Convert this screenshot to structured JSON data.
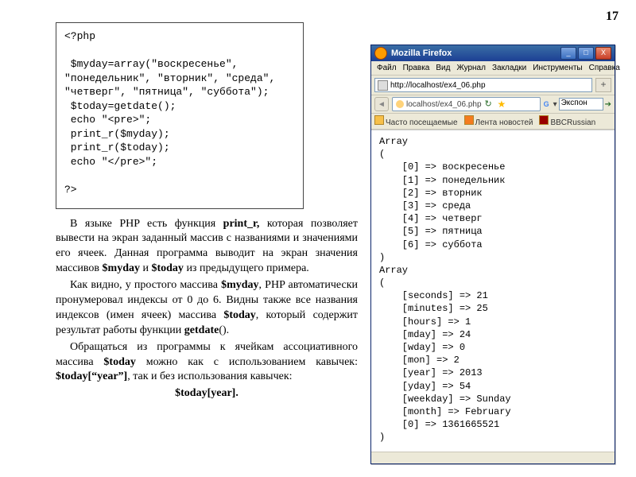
{
  "page_number": "17",
  "code": {
    "lines": [
      "<?php",
      "",
      " $myday=array(\"воскресенье\",",
      "\"понедельник\", \"вторник\", \"среда\",",
      "\"четверг\", \"пятница\", \"суббота\");",
      " $today=getdate();",
      " echo \"<pre>\";",
      " print_r($myday);",
      " print_r($today);",
      " echo \"</pre>\";",
      "",
      "?>"
    ]
  },
  "text": {
    "p1_a": "В  языке PHP есть  функция ",
    "p1_b": "print_r,",
    "p1_c": " которая позволяет вывести на  экран  заданный  массив  с названиями  и  значениями  его  ячеек. Данная  программа выводит на  экран  значения  массивов ",
    "p1_d": "$myday",
    "p1_e": " и ",
    "p1_f": "$today",
    "p1_g": " из предыдущего примера.",
    "p2_a": "Как  видно,  у  простого  массива ",
    "p2_b": "$myday",
    "p2_c": ", PHP автоматически пронумеровал индексы от 0 до 6.  Видны  также  все  названия  индексов (имен   ячеек)   массива  ",
    "p2_d": "$today",
    "p2_e": ",   который   содержит результат работы функции ",
    "p2_f": "getdate",
    "p2_g": "().",
    "p3_a": "Обращаться  из  программы  к  ячейкам ассоциативного массива ",
    "p3_b": "$today",
    "p3_c": " можно   как   с  использованием кавычек:  ",
    "p3_d": "$today[“year”]",
    "p3_e": ",  так  и  без  использования  кавычек:",
    "final": "$today[year]."
  },
  "firefox": {
    "title": "Mozilla Firefox",
    "menu": [
      "Файл",
      "Правка",
      "Вид",
      "Журнал",
      "Закладки",
      "Инструменты",
      "Справка"
    ],
    "tab_url": "http://localhost/ex4_06.php",
    "address": "localhost/ex4_06.php",
    "search_engine": "Экспон",
    "bookmarks": [
      "Часто посещаемые",
      "Лента новостей",
      "BBCRussian"
    ],
    "win_buttons": {
      "min": "_",
      "max": "□",
      "close": "X"
    }
  },
  "output": {
    "array1_header": "Array",
    "brace_open": "(",
    "brace_close": ")",
    "arr1": [
      "    [0] => воскресенье",
      "    [1] => понедельник",
      "    [2] => вторник",
      "    [3] => среда",
      "    [4] => четверг",
      "    [5] => пятница",
      "    [6] => суббота"
    ],
    "array2_header": "Array",
    "arr2": [
      "    [seconds] => 21",
      "    [minutes] => 25",
      "    [hours] => 1",
      "    [mday] => 24",
      "    [wday] => 0",
      "    [mon] => 2",
      "    [year] => 2013",
      "    [yday] => 54",
      "    [weekday] => Sunday",
      "    [month] => February",
      "    [0] => 1361665521"
    ]
  }
}
